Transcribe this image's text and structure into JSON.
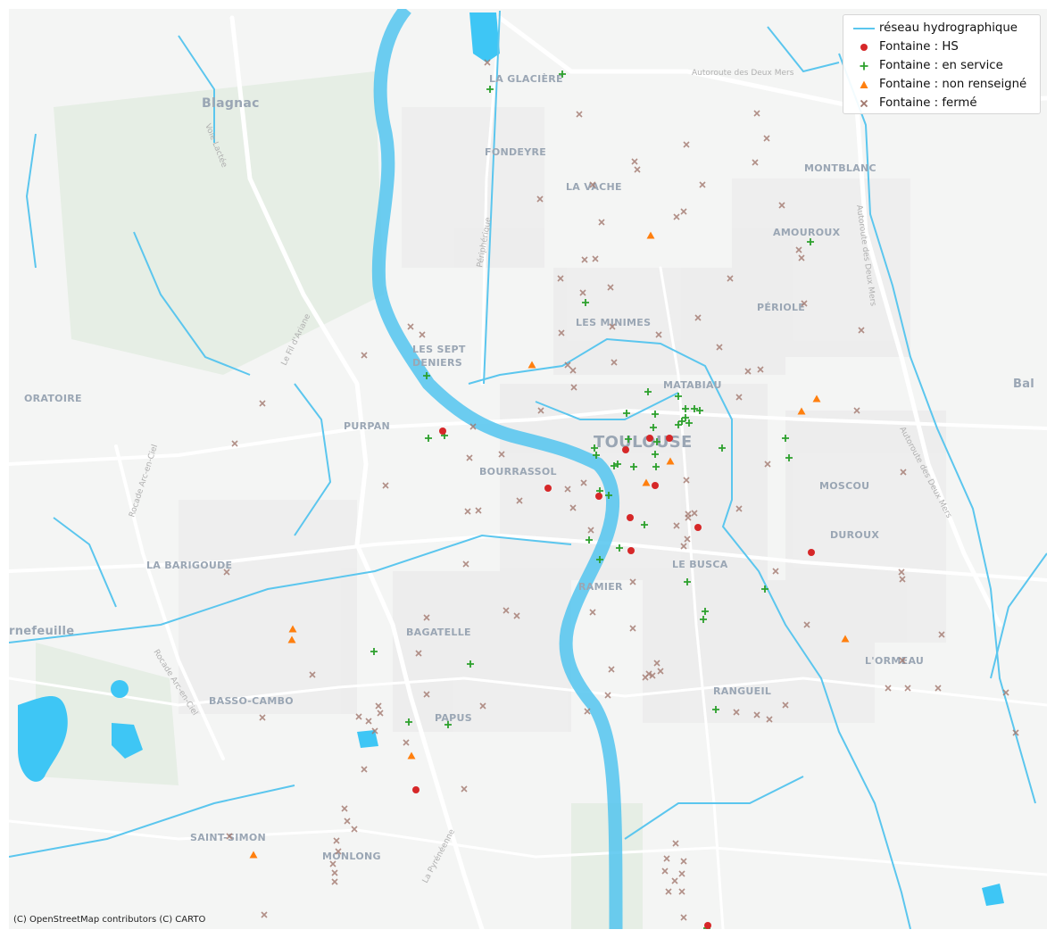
{
  "legend": {
    "items": [
      {
        "label": "réseau hydrographique",
        "symbol": "line",
        "color": "#5bc6ee"
      },
      {
        "label": "Fontaine : HS",
        "symbol": "circle",
        "color": "#d62728"
      },
      {
        "label": "Fontaine : en service",
        "symbol": "plus",
        "color": "#2ca02c"
      },
      {
        "label": "Fontaine : non renseigné",
        "symbol": "triangle",
        "color": "#ff7f0e"
      },
      {
        "label": "Fontaine : fermé",
        "symbol": "x",
        "color": "#a0766c"
      }
    ]
  },
  "attribution": "(C) OpenStreetMap contributors (C) CARTO",
  "places": [
    {
      "name": "Blagnac"
    },
    {
      "name": "LA GLACIÈRE"
    },
    {
      "name": "FONDEYRE"
    },
    {
      "name": "LA VACHE"
    },
    {
      "name": "MONTBLANC"
    },
    {
      "name": "AMOUROUX"
    },
    {
      "name": "PÉRIOLE"
    },
    {
      "name": "LES MINIMES"
    },
    {
      "name": "LES SEPT"
    },
    {
      "name": "DENIERS"
    },
    {
      "name": "MATABIAU"
    },
    {
      "name": "ORATOIRE"
    },
    {
      "name": "PURPAN"
    },
    {
      "name": "TOULOUSE"
    },
    {
      "name": "BOURRASSOL"
    },
    {
      "name": "MOSCOU"
    },
    {
      "name": "DUROUX"
    },
    {
      "name": "LE BUSCA"
    },
    {
      "name": "LA BARIGOUDE"
    },
    {
      "name": "RAMIER"
    },
    {
      "name": "rnefeuille"
    },
    {
      "name": "BAGATELLE"
    },
    {
      "name": "L'ORMEAU"
    },
    {
      "name": "RANGUEIL"
    },
    {
      "name": "BASSO-CAMBO"
    },
    {
      "name": "PAPUS"
    },
    {
      "name": "SAINT-SIMON"
    },
    {
      "name": "MONLONG"
    },
    {
      "name": "Bal"
    }
  ],
  "roads": [
    {
      "name": "Autoroute des Deux Mers"
    },
    {
      "name": "Autoroute des Deux Mers"
    },
    {
      "name": "Autoroute des Deux Mers"
    },
    {
      "name": "Voie Lactée"
    },
    {
      "name": "Le Fil d'Ariane"
    },
    {
      "name": "Rocade Arc-en-Ciel"
    },
    {
      "name": "Rocade Arc-en-Ciel"
    },
    {
      "name": "Périphérique"
    },
    {
      "name": "La Pyrénéenne"
    }
  ],
  "fountains": {
    "hs": [
      [
        496,
        483
      ],
      [
        701,
        504
      ],
      [
        728,
        491
      ],
      [
        750,
        491
      ],
      [
        614,
        547
      ],
      [
        671,
        556
      ],
      [
        734,
        544
      ],
      [
        706,
        580
      ],
      [
        782,
        591
      ],
      [
        707,
        617
      ],
      [
        909,
        619
      ],
      [
        466,
        885
      ],
      [
        793,
        1037
      ]
    ],
    "en_service": [
      [
        630,
        83
      ],
      [
        549,
        100
      ],
      [
        908,
        271
      ],
      [
        656,
        339
      ],
      [
        478,
        421
      ],
      [
        480,
        491
      ],
      [
        498,
        488
      ],
      [
        666,
        502
      ],
      [
        668,
        510
      ],
      [
        726,
        439
      ],
      [
        702,
        463
      ],
      [
        734,
        464
      ],
      [
        760,
        444
      ],
      [
        768,
        458
      ],
      [
        778,
        458
      ],
      [
        784,
        460
      ],
      [
        764,
        472
      ],
      [
        768,
        468
      ],
      [
        772,
        474
      ],
      [
        760,
        476
      ],
      [
        732,
        479
      ],
      [
        704,
        492
      ],
      [
        736,
        495
      ],
      [
        809,
        502
      ],
      [
        734,
        509
      ],
      [
        688,
        522
      ],
      [
        692,
        520
      ],
      [
        710,
        523
      ],
      [
        735,
        523
      ],
      [
        672,
        550
      ],
      [
        682,
        555
      ],
      [
        660,
        605
      ],
      [
        672,
        627
      ],
      [
        694,
        614
      ],
      [
        722,
        588
      ],
      [
        880,
        491
      ],
      [
        884,
        513
      ],
      [
        770,
        652
      ],
      [
        857,
        660
      ],
      [
        790,
        685
      ],
      [
        788,
        694
      ],
      [
        419,
        730
      ],
      [
        527,
        744
      ],
      [
        458,
        809
      ],
      [
        502,
        812
      ],
      [
        802,
        795
      ],
      [
        792,
        1040
      ]
    ],
    "non_renseigne": [
      [
        729,
        264
      ],
      [
        596,
        409
      ],
      [
        898,
        461
      ],
      [
        915,
        447
      ],
      [
        751,
        517
      ],
      [
        724,
        541
      ],
      [
        328,
        705
      ],
      [
        327,
        717
      ],
      [
        947,
        716
      ],
      [
        461,
        847
      ],
      [
        284,
        958
      ]
    ],
    "ferme": [
      [
        546,
        70
      ],
      [
        649,
        128
      ],
      [
        848,
        127
      ],
      [
        769,
        162
      ],
      [
        859,
        155
      ],
      [
        711,
        181
      ],
      [
        714,
        190
      ],
      [
        846,
        182
      ],
      [
        787,
        207
      ],
      [
        605,
        223
      ],
      [
        664,
        207
      ],
      [
        674,
        249
      ],
      [
        766,
        237
      ],
      [
        758,
        243
      ],
      [
        876,
        230
      ],
      [
        895,
        280
      ],
      [
        898,
        289
      ],
      [
        655,
        291
      ],
      [
        667,
        290
      ],
      [
        628,
        312
      ],
      [
        684,
        322
      ],
      [
        653,
        328
      ],
      [
        818,
        312
      ],
      [
        901,
        340
      ],
      [
        782,
        356
      ],
      [
        629,
        373
      ],
      [
        686,
        366
      ],
      [
        738,
        375
      ],
      [
        806,
        389
      ],
      [
        965,
        370
      ],
      [
        460,
        366
      ],
      [
        473,
        375
      ],
      [
        408,
        398
      ],
      [
        688,
        406
      ],
      [
        636,
        409
      ],
      [
        642,
        415
      ],
      [
        643,
        434
      ],
      [
        838,
        416
      ],
      [
        852,
        414
      ],
      [
        828,
        445
      ],
      [
        606,
        460
      ],
      [
        960,
        460
      ],
      [
        294,
        452
      ],
      [
        530,
        478
      ],
      [
        263,
        497
      ],
      [
        526,
        513
      ],
      [
        562,
        509
      ],
      [
        432,
        544
      ],
      [
        860,
        520
      ],
      [
        1012,
        529
      ],
      [
        769,
        538
      ],
      [
        771,
        576
      ],
      [
        524,
        573
      ],
      [
        536,
        572
      ],
      [
        582,
        561
      ],
      [
        642,
        569
      ],
      [
        654,
        541
      ],
      [
        636,
        548
      ],
      [
        828,
        570
      ],
      [
        778,
        575
      ],
      [
        771,
        580
      ],
      [
        758,
        589
      ],
      [
        770,
        604
      ],
      [
        766,
        612
      ],
      [
        662,
        594
      ],
      [
        522,
        632
      ],
      [
        254,
        641
      ],
      [
        709,
        652
      ],
      [
        869,
        640
      ],
      [
        1010,
        641
      ],
      [
        1011,
        649
      ],
      [
        567,
        684
      ],
      [
        579,
        690
      ],
      [
        478,
        692
      ],
      [
        664,
        686
      ],
      [
        904,
        700
      ],
      [
        709,
        704
      ],
      [
        1055,
        711
      ],
      [
        469,
        732
      ],
      [
        736,
        743
      ],
      [
        740,
        752
      ],
      [
        727,
        755
      ],
      [
        723,
        759
      ],
      [
        731,
        757
      ],
      [
        685,
        750
      ],
      [
        350,
        756
      ],
      [
        995,
        771
      ],
      [
        1017,
        771
      ],
      [
        1051,
        771
      ],
      [
        1011,
        740
      ],
      [
        1127,
        776
      ],
      [
        478,
        778
      ],
      [
        681,
        779
      ],
      [
        541,
        791
      ],
      [
        825,
        798
      ],
      [
        848,
        801
      ],
      [
        862,
        806
      ],
      [
        880,
        790
      ],
      [
        424,
        791
      ],
      [
        426,
        799
      ],
      [
        402,
        803
      ],
      [
        413,
        808
      ],
      [
        420,
        819
      ],
      [
        455,
        832
      ],
      [
        294,
        804
      ],
      [
        658,
        797
      ],
      [
        408,
        862
      ],
      [
        520,
        884
      ],
      [
        386,
        906
      ],
      [
        389,
        920
      ],
      [
        397,
        929
      ],
      [
        377,
        942
      ],
      [
        379,
        954
      ],
      [
        373,
        968
      ],
      [
        375,
        978
      ],
      [
        375,
        988
      ],
      [
        257,
        937
      ],
      [
        757,
        945
      ],
      [
        766,
        965
      ],
      [
        747,
        962
      ],
      [
        745,
        976
      ],
      [
        764,
        979
      ],
      [
        756,
        987
      ],
      [
        749,
        999
      ],
      [
        764,
        999
      ],
      [
        766,
        1028
      ],
      [
        1138,
        821
      ],
      [
        296,
        1025
      ]
    ]
  }
}
